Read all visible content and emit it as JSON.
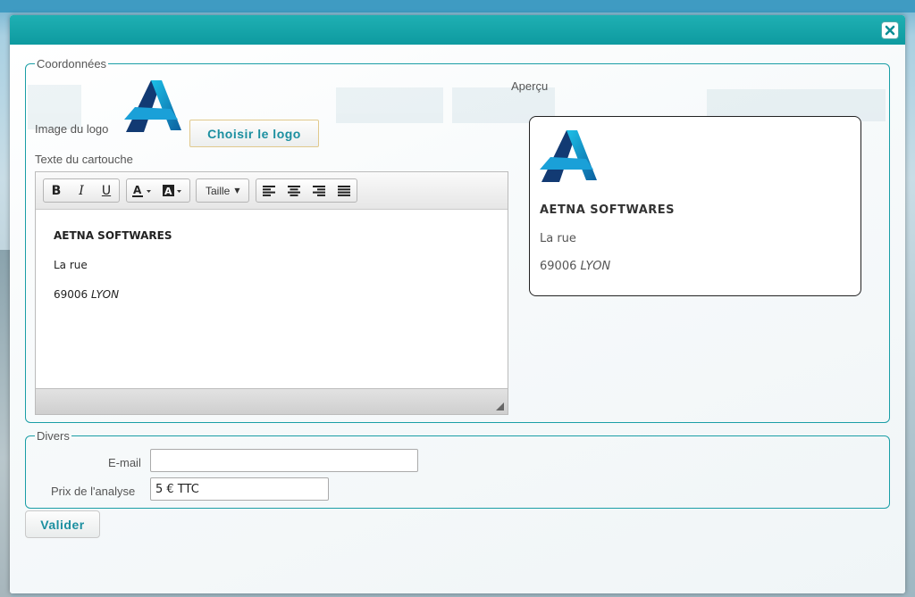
{
  "window": {
    "close_icon": "close-icon"
  },
  "coordonnees": {
    "legend": "Coordonnées",
    "logo_label": "Image du logo",
    "logo_button": "Choisir le logo",
    "text_label": "Texte du cartouche",
    "preview_label": "Aperçu",
    "toolbar": {
      "bold": "B",
      "italic": "I",
      "underline": "U",
      "font_color_icon": "font-color-icon",
      "bg_color_icon": "highlight-color-icon",
      "size_label": "Taille",
      "align_icons": [
        "align-left-icon",
        "align-center-icon",
        "align-right-icon",
        "align-justify-icon"
      ]
    },
    "content": {
      "company": "AETNA SOFTWARES",
      "street": "La rue",
      "postcode": "69006",
      "city": "LYON"
    },
    "preview": {
      "company": "AETNA SOFTWARES",
      "street": "La rue",
      "postcode": "69006",
      "city": "LYON"
    }
  },
  "divers": {
    "legend": "Divers",
    "email_label": "E-mail",
    "email_value": "",
    "price_label": "Prix de l'analyse",
    "price_value": "5 € TTC"
  },
  "actions": {
    "submit": "Valider"
  },
  "colors": {
    "accent": "#1a9ea6",
    "titlebar": "#13a4a9",
    "button_text": "#1b8fa0",
    "logo_dark": "#123a73",
    "logo_light": "#1aa0d8"
  }
}
